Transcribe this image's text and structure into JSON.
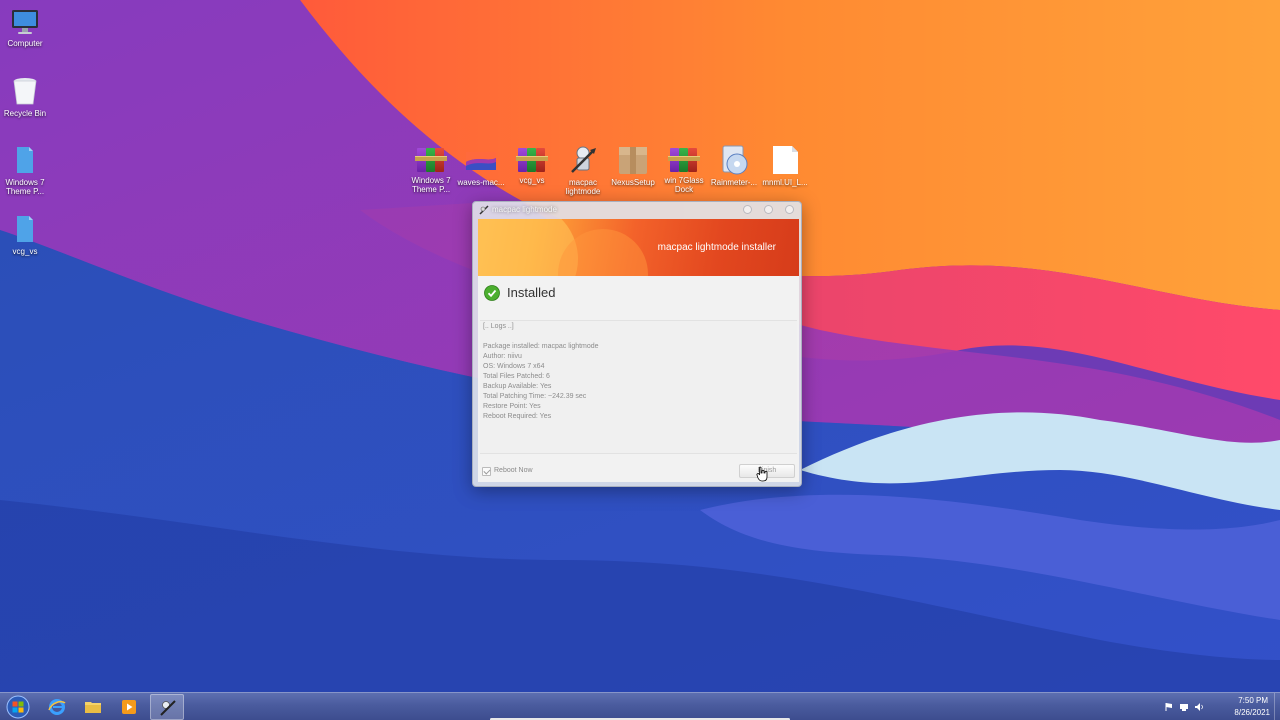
{
  "desktop": {
    "left_icons": [
      {
        "label": "Computer",
        "icon": "computer-icon"
      },
      {
        "label": "Recycle Bin",
        "icon": "recycle-bin-icon"
      },
      {
        "label": "Windows 7 Theme P...",
        "icon": "folder-icon"
      },
      {
        "label": "vcg_vs",
        "icon": "folder-icon"
      }
    ],
    "top_icons": [
      {
        "label": "Windows 7 Theme P...",
        "icon": "winrar-archive-icon"
      },
      {
        "label": "waves-mac...",
        "icon": "image-file-icon"
      },
      {
        "label": "vcg_vs",
        "icon": "winrar-archive-icon"
      },
      {
        "label": "macpac lightmode",
        "icon": "installer-icon"
      },
      {
        "label": "NexusSetup",
        "icon": "package-icon"
      },
      {
        "label": "win 7Glass Dock",
        "icon": "winrar-archive-icon"
      },
      {
        "label": "Rainmeter-...",
        "icon": "disc-installer-icon"
      },
      {
        "label": "mnml.UI_L...",
        "icon": "blank-file-icon"
      }
    ]
  },
  "window": {
    "title": "macpac lightmode",
    "banner_title": "macpac lightmode installer",
    "status": "Installed",
    "logs_header": "[.. Logs ..]",
    "log_lines": [
      "Package installed: macpac lightmode",
      "Author: niivu",
      "OS: Windows 7 x64",
      "Total Files Patched: 6",
      "Backup Available: Yes",
      "Total Patching Time: ~242.39 sec",
      "Restore Point: Yes",
      "Reboot Required: Yes"
    ],
    "reboot_label": "Reboot Now",
    "reboot_checked": true,
    "finish_label": "Finish"
  },
  "taskbar": {
    "items": [
      {
        "icon": "internet-explorer-icon"
      },
      {
        "icon": "file-explorer-icon"
      },
      {
        "icon": "media-player-icon"
      },
      {
        "icon": "macpac-installer-icon",
        "active": true
      }
    ],
    "time": "7:50 PM",
    "date": "8/26/2021"
  },
  "colors": {
    "banner_start": "#ffb84d",
    "banner_end": "#d63c1a",
    "check_green": "#4caf2f",
    "taskbar": "#4a5b9e"
  }
}
